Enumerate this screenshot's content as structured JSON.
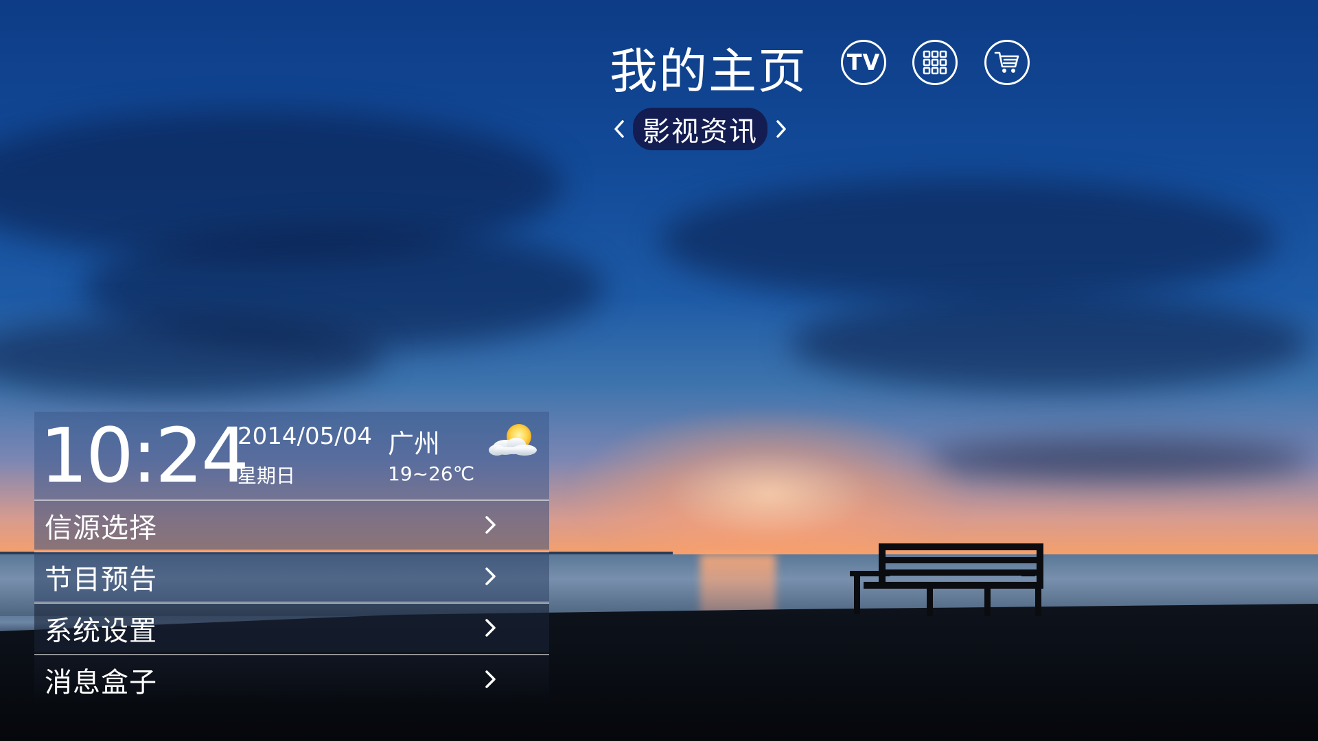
{
  "header": {
    "title": "我的主页",
    "buttons": [
      {
        "label": "TV",
        "icon": "tv-icon"
      },
      {
        "icon": "apps-grid-icon"
      },
      {
        "icon": "shopping-cart-icon"
      }
    ],
    "sub_nav": {
      "current": "影视资讯",
      "prev_icon": "chevron-left-icon",
      "next_icon": "chevron-right-icon"
    }
  },
  "info": {
    "time": "10:24",
    "date": "2014/05/04",
    "weekday": "星期日",
    "city": "广州",
    "temperature": "19~26℃",
    "weather_icon": "partly-cloudy-icon"
  },
  "menu": [
    {
      "label": "信源选择",
      "icon": "chevron-right-icon"
    },
    {
      "label": "节目预告",
      "icon": "chevron-right-icon"
    },
    {
      "label": "系统设置",
      "icon": "chevron-right-icon"
    },
    {
      "label": "消息盒子",
      "icon": "chevron-right-icon"
    }
  ],
  "colors": {
    "sky_top": "#0e3c86",
    "sunset": "#f6a06a",
    "pill_bg": "#14164a",
    "panel_bg": "#3c5a8c"
  }
}
